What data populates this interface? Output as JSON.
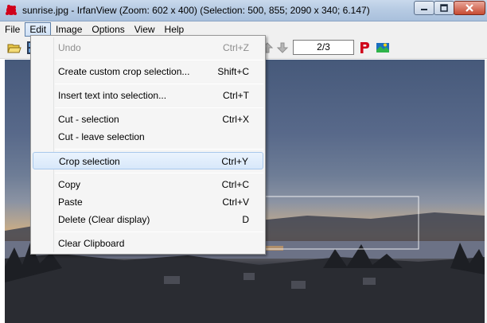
{
  "window": {
    "title": "sunrise.jpg - IrfanView (Zoom: 602 x 400) (Selection: 500, 855; 2090 x 340; 6.147)",
    "icon": "irfanview-red-cat-icon",
    "controls": [
      "minimize",
      "maximize",
      "close"
    ]
  },
  "menubar": {
    "items": [
      {
        "label": "File"
      },
      {
        "label": "Edit",
        "active": true
      },
      {
        "label": "Image"
      },
      {
        "label": "Options"
      },
      {
        "label": "View"
      },
      {
        "label": "Help"
      }
    ]
  },
  "toolbar": {
    "page_counter": "2/3",
    "icons": [
      "open-folder-icon",
      "filmstrip-icon",
      "up-arrow-icon",
      "down-arrow-icon",
      "print-p-icon",
      "irfanview-logo-icon"
    ]
  },
  "edit_menu": {
    "items": [
      {
        "label": "Undo",
        "shortcut": "Ctrl+Z",
        "disabled": true
      },
      {
        "label": "Create custom crop selection...",
        "shortcut": "Shift+C"
      },
      {
        "label": "Insert text into selection...",
        "shortcut": "Ctrl+T"
      },
      {
        "label": "Cut - selection",
        "shortcut": "Ctrl+X"
      },
      {
        "label": "Cut - leave selection",
        "shortcut": ""
      },
      {
        "label": "Crop selection",
        "shortcut": "Ctrl+Y",
        "highlighted": true
      },
      {
        "label": "Copy",
        "shortcut": "Ctrl+C"
      },
      {
        "label": "Paste",
        "shortcut": "Ctrl+V"
      },
      {
        "label": "Delete (Clear display)",
        "shortcut": "D"
      },
      {
        "label": "Clear Clipboard",
        "shortcut": ""
      }
    ]
  },
  "colors": {
    "title_bar": "#b7cbe3",
    "menu_highlight": "#d8e8fa",
    "close_button": "#c74b32",
    "print_icon": "#d0021b"
  }
}
